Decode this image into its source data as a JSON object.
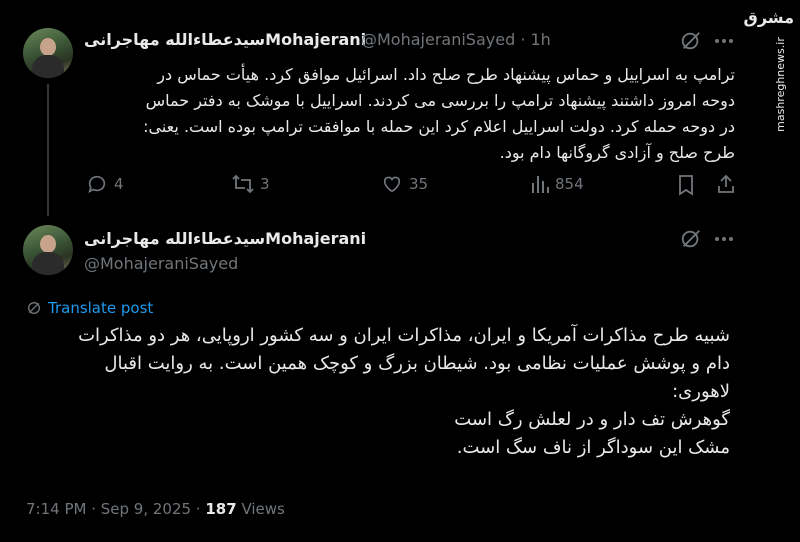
{
  "watermark": {
    "logo": "مشرق",
    "url": "mashreghnews.ir"
  },
  "tweet1": {
    "name": "سیدعطاءالله مهاجرانیMohajerani",
    "handle": "@MohajeraniSayed",
    "time": "· 1h",
    "lines": [
      "ترامپ به اسراییل و حماس پیشنهاد طرح صلح داد. اسرائیل موافق کرد. هیأت حماس در",
      "دوحه امروز داشتند پیشنهاد ترامپ را بررسی می کردند. اسراییل با موشک به دفتر حماس",
      "در دوحه حمله کرد. دولت اسراییل اعلام کرد این حمله با موافقت ترامپ بوده است. یعنی:",
      "طرح صلح و آزادی گروگانها دام بود."
    ],
    "replies": "4",
    "reposts": "3",
    "likes": "35",
    "views": "854"
  },
  "tweet2": {
    "name": "سیدعطاءالله مهاجرانیMohajerani",
    "handle": "@MohajeraniSayed",
    "translate": "Translate post",
    "lines": [
      "شبیه طرح مذاکرات آمریکا و ایران، مذاکرات ایران و سه کشور اروپایی، هر دو مذاکرات",
      "دام و پوشش عملیات نظامی بود. شیطان بزرگ و کوچک همین است. به روایت اقبال",
      "لاهوری:",
      "گوهرش تف دار و در لعلش رگ است",
      "مشک این سوداگر از ناف سگ است."
    ],
    "timestamp": "7:14 PM · Sep 9, 2025 ·",
    "views_count": "187",
    "views_label": "Views"
  }
}
